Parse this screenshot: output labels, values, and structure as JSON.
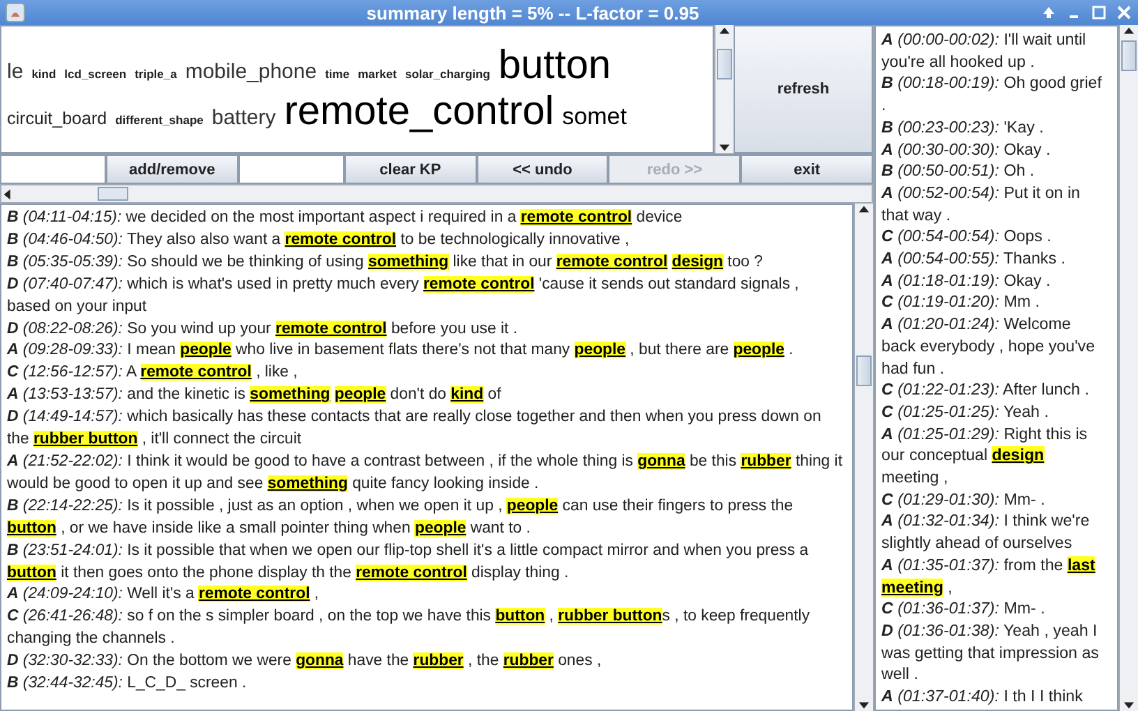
{
  "window": {
    "title": "summary length = 5% -- L-factor = 0.95"
  },
  "keyword_cloud": {
    "tags": [
      {
        "text": "le",
        "kind": "medium"
      },
      {
        "text": "kind",
        "kind": "tiny"
      },
      {
        "text": "lcd_screen",
        "kind": "tiny"
      },
      {
        "text": "triple_a",
        "kind": "tiny"
      },
      {
        "text": "mobile_phone",
        "kind": "medium"
      },
      {
        "text": "time",
        "kind": "tiny"
      },
      {
        "text": "market",
        "kind": "tiny"
      },
      {
        "text": "solar_charging",
        "kind": "tiny"
      },
      {
        "text": "button",
        "kind": "huge"
      },
      {
        "text": "circuit_board",
        "kind": "small"
      },
      {
        "text": "different_shape",
        "kind": "tiny"
      },
      {
        "text": "battery",
        "kind": "medium"
      },
      {
        "text": "remote_control",
        "kind": "huge"
      },
      {
        "text": "somet",
        "kind": "large"
      }
    ]
  },
  "refresh_button": {
    "label": "refresh"
  },
  "toolbar": [
    {
      "kind": "field"
    },
    {
      "kind": "button",
      "label": "add/remove",
      "disabled": false
    },
    {
      "kind": "field"
    },
    {
      "kind": "button",
      "label": "clear KP",
      "disabled": false
    },
    {
      "kind": "button",
      "label": "<< undo",
      "disabled": false
    },
    {
      "kind": "button",
      "label": "redo >>",
      "disabled": true
    },
    {
      "kind": "button",
      "label": "exit",
      "disabled": false
    }
  ],
  "summary_transcript": [
    {
      "speaker": "B",
      "time": "(04:11-04:15):",
      "text": "we decided on the most important aspect i required in a **remote control** device"
    },
    {
      "speaker": "B",
      "time": "(04:46-04:50):",
      "text": "They also also want a **remote control** to be technologically innovative ,"
    },
    {
      "speaker": "B",
      "time": "(05:35-05:39):",
      "text": "So should we be thinking of using **something** like that in our **remote control** **design** too ?"
    },
    {
      "speaker": "D",
      "time": "(07:40-07:47):",
      "text": "which is what's used in pretty much every **remote control** 'cause it sends out standard signals , based on your input"
    },
    {
      "speaker": "D",
      "time": "(08:22-08:26):",
      "text": "So you wind up your **remote control** before you use it ."
    },
    {
      "speaker": "A",
      "time": "(09:28-09:33):",
      "text": "I mean **people** who live in basement flats there's not that many **people** , but there are **people** ."
    },
    {
      "speaker": "C",
      "time": "(12:56-12:57):",
      "text": "A **remote control** , like ,"
    },
    {
      "speaker": "A",
      "time": "(13:53-13:57):",
      "text": "and the kinetic is **something** **people** don't do **kind** of"
    },
    {
      "speaker": "D",
      "time": "(14:49-14:57):",
      "text": "which basically has these contacts that are really close together and then when you press down on the **rubber button** , it'll connect the circuit"
    },
    {
      "speaker": "A",
      "time": "(21:52-22:02):",
      "text": "I think it would be good to have a contrast between , if the whole thing is **gonna** be this **rubber** thing it would be good to open it up and see **something** quite fancy looking inside ."
    },
    {
      "speaker": "B",
      "time": "(22:14-22:25):",
      "text": "Is it possible , just as an option , when we open it up , **people** can use their fingers to press the **button** , or we have inside like a small pointer thing when **people** want to ."
    },
    {
      "speaker": "B",
      "time": "(23:51-24:01):",
      "text": "Is it possible that when we open our flip-top shell it's a little compact mirror and when you press a **button** it then goes onto the phone display th the **remote control** display thing ."
    },
    {
      "speaker": "A",
      "time": "(24:09-24:10):",
      "text": "Well it's a **remote control** ,"
    },
    {
      "speaker": "C",
      "time": "(26:41-26:48):",
      "text": "so f on the s simpler board , on the top we have this **button** , **rubber button**s , to keep frequently changing the channels ."
    },
    {
      "speaker": "D",
      "time": "(32:30-32:33):",
      "text": "On the bottom we were **gonna** have the **rubber** , the **rubber** ones ,"
    },
    {
      "speaker": "B",
      "time": "(32:44-32:45):",
      "text": "L_C_D_ screen ."
    }
  ],
  "full_transcript": [
    {
      "speaker": "A",
      "time": "(00:00-00:02):",
      "text": "I'll wait until you're all hooked up ."
    },
    {
      "speaker": "B",
      "time": "(00:18-00:19):",
      "text": "Oh good grief ."
    },
    {
      "speaker": "B",
      "time": "(00:23-00:23):",
      "text": "'Kay ."
    },
    {
      "speaker": "A",
      "time": "(00:30-00:30):",
      "text": "Okay ."
    },
    {
      "speaker": "B",
      "time": "(00:50-00:51):",
      "text": "Oh ."
    },
    {
      "speaker": "A",
      "time": "(00:52-00:54):",
      "text": "Put it on in that way ."
    },
    {
      "speaker": "C",
      "time": "(00:54-00:54):",
      "text": "Oops ."
    },
    {
      "speaker": "A",
      "time": "(00:54-00:55):",
      "text": "Thanks ."
    },
    {
      "speaker": "A",
      "time": "(01:18-01:19):",
      "text": "Okay ."
    },
    {
      "speaker": "C",
      "time": "(01:19-01:20):",
      "text": "Mm ."
    },
    {
      "speaker": "A",
      "time": "(01:20-01:24):",
      "text": "Welcome back everybody , hope you've had fun ."
    },
    {
      "speaker": "C",
      "time": "(01:22-01:23):",
      "text": "After lunch ."
    },
    {
      "speaker": "C",
      "time": "(01:25-01:25):",
      "text": "Yeah ."
    },
    {
      "speaker": "A",
      "time": "(01:25-01:29):",
      "text": "Right this is our conceptual **design** meeting ,"
    },
    {
      "speaker": "C",
      "time": "(01:29-01:30):",
      "text": "Mm- ."
    },
    {
      "speaker": "A",
      "time": "(01:32-01:34):",
      "text": "I think we're slightly ahead of ourselves"
    },
    {
      "speaker": "A",
      "time": "(01:35-01:37):",
      "text": "from the **last meeting** ,"
    },
    {
      "speaker": "C",
      "time": "(01:36-01:37):",
      "text": "Mm- ."
    },
    {
      "speaker": "D",
      "time": "(01:36-01:38):",
      "text": "Yeah , yeah I was getting that impression as well ."
    },
    {
      "speaker": "A",
      "time": "(01:37-01:40):",
      "text": "I th I I think"
    }
  ]
}
